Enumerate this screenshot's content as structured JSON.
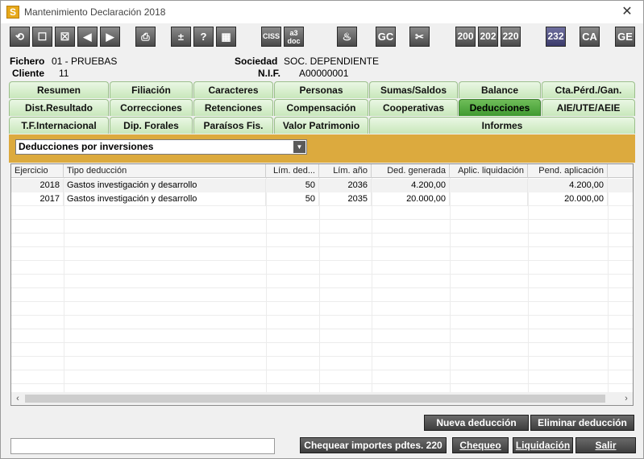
{
  "window": {
    "title": "Mantenimiento Declaración 2018",
    "app_letter": "S"
  },
  "toolbar": {
    "buttons": [
      {
        "icon": "refresh-icon",
        "label": "⟲"
      },
      {
        "icon": "square-icon",
        "label": "☐"
      },
      {
        "icon": "cancel-box-icon",
        "label": "☒"
      },
      {
        "icon": "prev-icon",
        "label": "◀"
      },
      {
        "icon": "next-icon",
        "label": "▶"
      },
      {
        "icon": "printer-icon",
        "label": "⎙"
      },
      {
        "icon": "plus-minus-icon",
        "label": "±"
      },
      {
        "icon": "help-icon",
        "label": "?"
      },
      {
        "icon": "calculator-icon",
        "label": "▦"
      },
      {
        "icon": "ciss-icon",
        "label": "CISS"
      },
      {
        "icon": "a3doc-icon",
        "label": "a3 doc"
      },
      {
        "icon": "alarm-icon",
        "label": "♨"
      },
      {
        "icon": "gc-icon",
        "label": "GC"
      },
      {
        "icon": "tools-icon",
        "label": "✂"
      },
      {
        "icon": "model-200-icon",
        "label": "200"
      },
      {
        "icon": "model-202-icon",
        "label": "202"
      },
      {
        "icon": "model-220-icon",
        "label": "220"
      },
      {
        "icon": "model-232-icon",
        "label": "232"
      },
      {
        "icon": "ca-icon",
        "label": "CA"
      },
      {
        "icon": "ge-icon",
        "label": "GE"
      }
    ]
  },
  "header": {
    "fichero_label": "Fichero",
    "fichero_value": "01 - PRUEBAS",
    "cliente_label": "Cliente",
    "cliente_value": "11",
    "sociedad_label": "Sociedad",
    "sociedad_value": "SOC. DEPENDIENTE",
    "nif_label": "N.I.F.",
    "nif_value": "A00000001"
  },
  "tabs": {
    "row1": [
      "Resumen",
      "Filiación",
      "Caracteres",
      "Personas",
      "Sumas/Saldos",
      "Balance",
      "Cta.Pérd./Gan."
    ],
    "row2": [
      "Dist.Resultado",
      "Correcciones",
      "Retenciones",
      "Compensación",
      "Cooperativas",
      "Deducciones",
      "AIE/UTE/AEIE"
    ],
    "row3": [
      "T.F.Internacional",
      "Dip. Forales",
      "Paraísos Fis.",
      "Valor Patrimonio",
      "Informes"
    ],
    "active": "Deducciones"
  },
  "filter": {
    "selected": "Deducciones por inversiones"
  },
  "grid": {
    "columns": [
      "Ejercicio",
      "Tipo deducción",
      "Lím. ded...",
      "Lím. año",
      "Ded. generada",
      "Aplic. liquidación",
      "Pend. aplicación"
    ],
    "rows": [
      [
        "2018",
        "Gastos investigación y desarrollo",
        "50",
        "2036",
        "4.200,00",
        "",
        "4.200,00"
      ],
      [
        "2017",
        "Gastos investigación y desarrollo",
        "50",
        "2035",
        "20.000,00",
        "",
        "20.000,00"
      ]
    ]
  },
  "actions": {
    "nueva": "Nueva deducción",
    "eliminar": "Eliminar deducción",
    "chequear": "Chequear importes pdtes. 220",
    "chequeo": "Chequeo",
    "liquidacion": "Liquidación",
    "salir": "Salir"
  }
}
